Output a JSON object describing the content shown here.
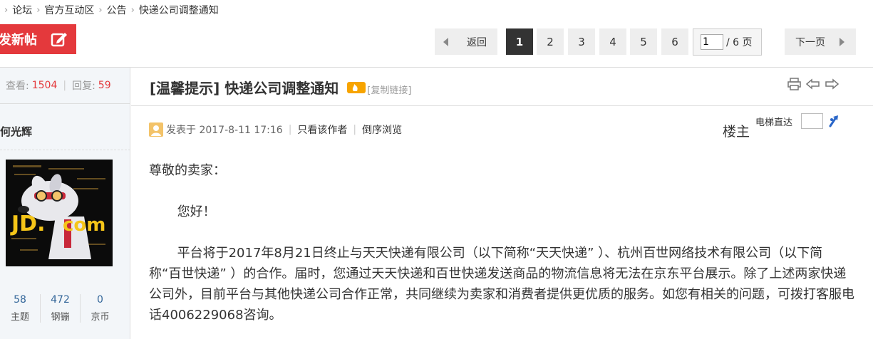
{
  "breadcrumb": [
    "论坛",
    "官方互动区",
    "公告",
    "快递公司调整通知"
  ],
  "new_post_label": "发新帖",
  "pager": {
    "back": "返回",
    "pages": [
      "1",
      "2",
      "3",
      "4",
      "5",
      "6"
    ],
    "current": "1",
    "total": "/ 6 页",
    "next": "下一页"
  },
  "sidebar": {
    "views_label": "查看:",
    "views": "1504",
    "replies_label": "回复:",
    "replies": "59",
    "author": "何光辉",
    "counts": [
      {
        "value": "58",
        "label": "主题"
      },
      {
        "value": "472",
        "label": "钢镚"
      },
      {
        "value": "0",
        "label": "京币"
      }
    ]
  },
  "post": {
    "title": "[温馨提示] 快递公司调整通知",
    "copy_link": "[复制链接]",
    "posted_label": "发表于 2017-8-11 17:16",
    "only_author": "只看该作者",
    "reverse": "倒序浏览",
    "floor": "楼主",
    "elevator": "电梯直达",
    "greeting": "尊敬的卖家：",
    "hello": "您好！",
    "paragraph": "平台将于2017年8月21日终止与天天快递有限公司（以下简称“天天快递” ）、杭州百世网络技术有限公司（以下简称“百世快递” ）的合作。届时，您通过天天快递和百世快递发送商品的物流信息将无法在京东平台展示。除了上述两家快递公司外，目前平台与其他快递公司合作正常，共同继续为卖家和消费者提供更优质的服务。如您有相关的问题，可拨打客服电话4006229068咨询。"
  },
  "colors": {
    "accent": "#e4393c",
    "link": "#336699"
  },
  "icons": [
    "chevron-right-icon",
    "edit-icon",
    "chevron-left-icon",
    "fire-icon",
    "print-icon",
    "prev-thread-icon",
    "next-thread-icon",
    "user-icon",
    "go-icon"
  ]
}
